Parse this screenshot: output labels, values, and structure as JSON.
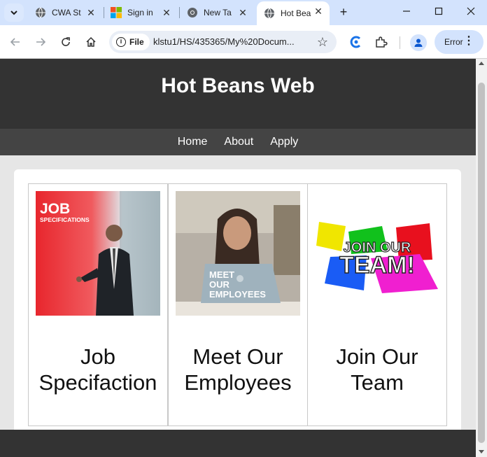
{
  "browser": {
    "tabs": [
      {
        "title": "CWA St",
        "icon": "globe-icon"
      },
      {
        "title": "Sign in",
        "icon": "microsoft-icon"
      },
      {
        "title": "New Ta",
        "icon": "chrome-icon"
      },
      {
        "title": "Hot Bea",
        "icon": "globe-icon",
        "active": true
      }
    ],
    "address": {
      "chip": "File",
      "url": "klstu1/HS/435365/My%20Docum..."
    },
    "error_label": "Error"
  },
  "site": {
    "title": "Hot Beans Web",
    "nav": [
      "Home",
      "About",
      "Apply"
    ],
    "cards": [
      {
        "caption": "Job Specifaction",
        "image_text_big": "JOB",
        "image_text_small": "SPECIFICATIONS"
      },
      {
        "caption": "Meet Our Employees",
        "image_text": [
          "MEET",
          "OUR",
          "EMPLOYEES"
        ]
      },
      {
        "caption": "Join Our Team",
        "image_text_top": "JOIN OUR",
        "image_text_big": "TEAM!"
      }
    ]
  }
}
